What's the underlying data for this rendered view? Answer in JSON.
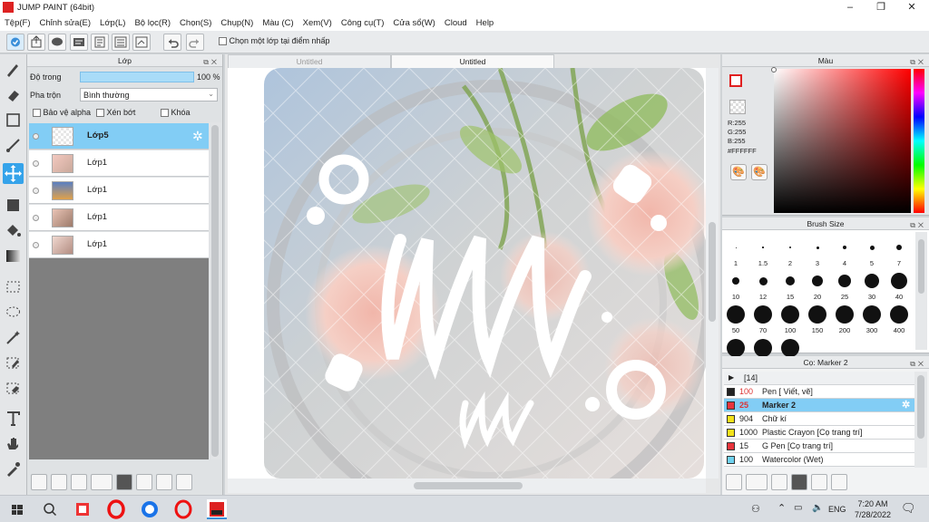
{
  "app": {
    "title": "JUMP PAINT (64bit)"
  },
  "menu": [
    "Tệp(F)",
    "Chỉnh sửa(E)",
    "Lớp(L)",
    "Bộ lọc(R)",
    "Chọn(S)",
    "Chụp(N)",
    "Màu (C)",
    "Xem(V)",
    "Công cụ(T)",
    "Cửa sổ(W)",
    "Cloud",
    "Help"
  ],
  "toolbar": {
    "select_on_click_label": "Chọn một lớp tại điểm nhấp"
  },
  "layer_panel": {
    "title": "Lớp",
    "opacity_label": "Độ trong",
    "opacity_value": "100 %",
    "blend_label": "Pha trộn",
    "blend_value": "Bình thường",
    "protect_alpha_label": "Bảo vệ alpha",
    "clipping_label": "Xén bớt",
    "lock_label": "Khóa",
    "layers": [
      {
        "name": "Lớp5",
        "active": true
      },
      {
        "name": "Lớp1",
        "active": false
      },
      {
        "name": "Lớp1",
        "active": false
      },
      {
        "name": "Lớp1",
        "active": false
      },
      {
        "name": "Lớp1",
        "active": false
      }
    ]
  },
  "canvas": {
    "tabs": [
      "Untitled",
      "Untitled"
    ]
  },
  "color_panel": {
    "title": "Màu",
    "r": "R:255",
    "g": "G:255",
    "b": "B:255",
    "hex": "#FFFFFF"
  },
  "brush_size_panel": {
    "title": "Brush Size",
    "sizes": [
      "1",
      "1.5",
      "2",
      "3",
      "4",
      "5",
      "7",
      "10",
      "12",
      "15",
      "20",
      "25",
      "30",
      "40",
      "50",
      "70",
      "100",
      "150",
      "200",
      "300",
      "400",
      "",
      "",
      ""
    ]
  },
  "brush_list": {
    "title": "Cọ: Marker 2",
    "group_label": "[14]",
    "items": [
      {
        "size": "100",
        "name": "Pen [ Viết, vẽ]",
        "color": "#222222",
        "active": false
      },
      {
        "size": "25",
        "name": "Marker 2",
        "color": "#e8343c",
        "active": true
      },
      {
        "size": "904",
        "name": "Chữ kí",
        "color": "#f4e21a",
        "active": false
      },
      {
        "size": "1000",
        "name": "Plastic Crayon [Cọ trang trí]",
        "color": "#f4e21a",
        "active": false
      },
      {
        "size": "15",
        "name": "G Pen [Cọ trang trí]",
        "color": "#e8343c",
        "active": false
      },
      {
        "size": "100",
        "name": "Watercolor (Wet)",
        "color": "#6fd2f0",
        "active": false
      }
    ]
  },
  "taskbar": {
    "lang": "ENG",
    "time": "7:20 AM",
    "date": "7/28/2022"
  }
}
